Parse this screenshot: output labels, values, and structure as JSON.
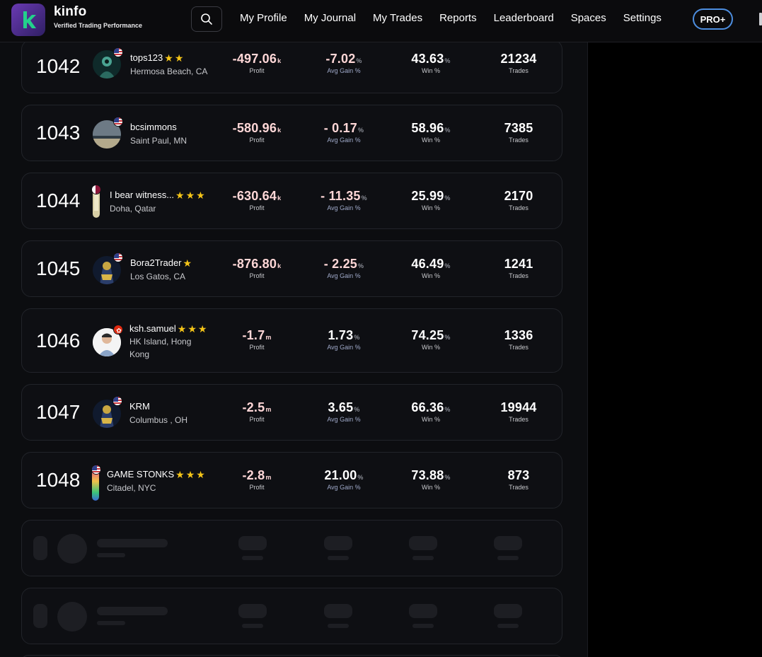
{
  "brand": {
    "name": "kinfo",
    "tagline": "Verified Trading Performance",
    "accent": "#6a3ab3",
    "logo_mark_color": "#23d18b"
  },
  "nav": {
    "search_icon": "search-icon",
    "items": [
      "My Profile",
      "My Journal",
      "My Trades",
      "Reports",
      "Leaderboard",
      "Spaces",
      "Settings"
    ],
    "pro_label": "PRO+"
  },
  "labels": {
    "profit": "Profit",
    "avg_gain": "Avg Gain %",
    "win": "Win %",
    "trades": "Trades"
  },
  "rows": [
    {
      "rank": "1042",
      "name": "tops123",
      "stars": 2,
      "location": "Hermosa Beach, CA",
      "flag": "us",
      "profit": "-497.06",
      "profit_unit": "k",
      "avg_gain": "-7.02",
      "avg_gain_unit": "%",
      "win": "43.63",
      "win_unit": "%",
      "trades": "21234"
    },
    {
      "rank": "1043",
      "name": "bcsimmons",
      "stars": 0,
      "location": "Saint Paul, MN",
      "flag": "us",
      "profit": "-580.96",
      "profit_unit": "k",
      "avg_gain": "- 0.17",
      "avg_gain_unit": "%",
      "win": "58.96",
      "win_unit": "%",
      "trades": "7385"
    },
    {
      "rank": "1044",
      "name": "I bear witness...",
      "stars": 3,
      "location": "Doha, Qatar",
      "flag": "qa",
      "profit": "-630.64",
      "profit_unit": "k",
      "avg_gain": "- 11.35",
      "avg_gain_unit": "%",
      "win": "25.99",
      "win_unit": "%",
      "trades": "2170"
    },
    {
      "rank": "1045",
      "name": "Bora2Trader",
      "stars": 1,
      "location": "Los Gatos, CA",
      "flag": "us",
      "profit": "-876.80",
      "profit_unit": "k",
      "avg_gain": "- 2.25",
      "avg_gain_unit": "%",
      "win": "46.49",
      "win_unit": "%",
      "trades": "1241"
    },
    {
      "rank": "1046",
      "name": "ksh.samuel",
      "stars": 3,
      "location_line1": "HK Island, Hong",
      "location_line2": "Kong",
      "flag": "hk",
      "profit": "-1.7",
      "profit_unit": "m",
      "avg_gain": "1.73",
      "avg_gain_unit": "%",
      "win": "74.25",
      "win_unit": "%",
      "trades": "1336"
    },
    {
      "rank": "1047",
      "name": "KRM",
      "stars": 0,
      "location": "Columbus , OH",
      "flag": "us",
      "profit": "-2.5",
      "profit_unit": "m",
      "avg_gain": "3.65",
      "avg_gain_unit": "%",
      "win": "66.36",
      "win_unit": "%",
      "trades": "19944"
    },
    {
      "rank": "1048",
      "name": "GAME STONKS",
      "stars": 3,
      "location": "Citadel, NYC",
      "flag": "us",
      "profit": "-2.8",
      "profit_unit": "m",
      "avg_gain": "21.00",
      "avg_gain_unit": "%",
      "win": "73.88",
      "win_unit": "%",
      "trades": "873"
    }
  ],
  "colors": {
    "negative_value": "#ffd7d7",
    "star": "#f5c518",
    "pro_border": "#4d8ee0"
  }
}
